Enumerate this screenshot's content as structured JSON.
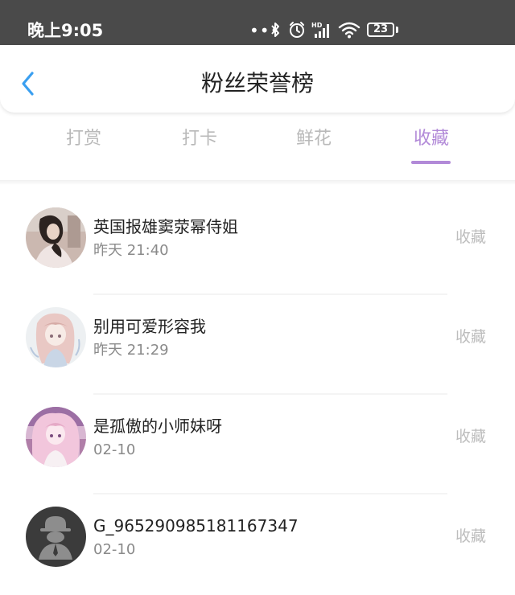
{
  "status_bar": {
    "time": "晚上9:05",
    "battery": "23",
    "icons": [
      "more-dots-icon",
      "bluetooth-icon",
      "alarm-icon",
      "signal-hd-icon",
      "wifi-icon",
      "battery-icon"
    ]
  },
  "header": {
    "title": "粉丝荣誉榜",
    "back_icon": "chevron-left-icon"
  },
  "tabs": [
    {
      "label": "打赏",
      "active": false
    },
    {
      "label": "打卡",
      "active": false
    },
    {
      "label": "鲜花",
      "active": false
    },
    {
      "label": "收藏",
      "active": true
    }
  ],
  "list": [
    {
      "name": "英国报雄窦荥幂侍姐",
      "time": "昨天 21:40",
      "action": "收藏"
    },
    {
      "name": "别用可爱形容我",
      "time": "昨天 21:29",
      "action": "收藏"
    },
    {
      "name": "是孤傲的小师妹呀",
      "time": "02-10",
      "action": "收藏"
    },
    {
      "name": "G_965290985181167347",
      "time": "02-10",
      "action": "收藏"
    }
  ],
  "colors": {
    "accent": "#b28ad8",
    "back_arrow": "#3a9ff0",
    "status_bar_bg": "#4a4a4a"
  }
}
